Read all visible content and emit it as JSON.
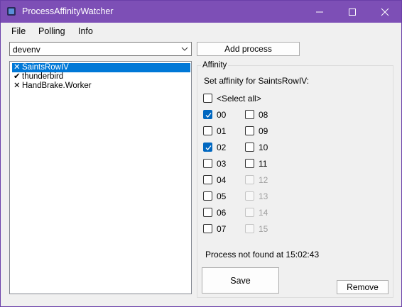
{
  "window": {
    "title": "ProcessAffinityWatcher"
  },
  "menu": [
    "File",
    "Polling",
    "Info"
  ],
  "process_combo": {
    "value": "devenv"
  },
  "add_button": "Add process",
  "processes": [
    {
      "mark": "✕",
      "name": "SaintsRowIV",
      "selected": true
    },
    {
      "mark": "✔",
      "name": "thunderbird",
      "selected": false
    },
    {
      "mark": "✕",
      "name": "HandBrake.Worker",
      "selected": false
    }
  ],
  "affinity": {
    "group_title": "Affinity",
    "set_label": "Set affinity for SaintsRowIV:",
    "select_all": "<Select all>",
    "cores_left": [
      {
        "label": "00",
        "checked": true,
        "enabled": true
      },
      {
        "label": "01",
        "checked": false,
        "enabled": true
      },
      {
        "label": "02",
        "checked": true,
        "enabled": true
      },
      {
        "label": "03",
        "checked": false,
        "enabled": true
      },
      {
        "label": "04",
        "checked": false,
        "enabled": true
      },
      {
        "label": "05",
        "checked": false,
        "enabled": true
      },
      {
        "label": "06",
        "checked": false,
        "enabled": true
      },
      {
        "label": "07",
        "checked": false,
        "enabled": true
      }
    ],
    "cores_right": [
      {
        "label": "08",
        "checked": false,
        "enabled": true
      },
      {
        "label": "09",
        "checked": false,
        "enabled": true
      },
      {
        "label": "10",
        "checked": false,
        "enabled": true
      },
      {
        "label": "11",
        "checked": false,
        "enabled": true
      },
      {
        "label": "12",
        "checked": false,
        "enabled": false
      },
      {
        "label": "13",
        "checked": false,
        "enabled": false
      },
      {
        "label": "14",
        "checked": false,
        "enabled": false
      },
      {
        "label": "15",
        "checked": false,
        "enabled": false
      }
    ],
    "status": "Process not found at 15:02:43",
    "save_button": "Save",
    "remove_button": "Remove"
  },
  "colors": {
    "titlebar": "#7d4fb6",
    "selection": "#0078d7",
    "checked": "#0067c0"
  }
}
